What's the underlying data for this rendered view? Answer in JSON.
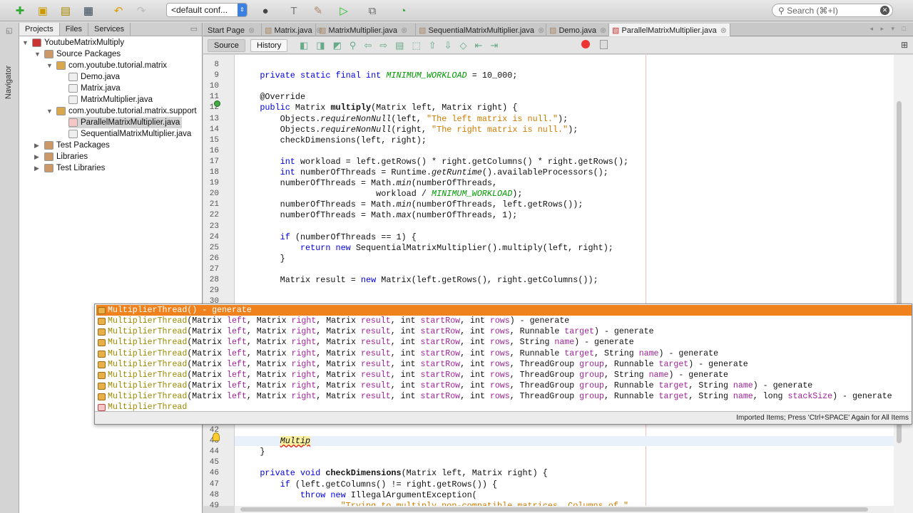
{
  "toolbar": {
    "config": "<default conf...",
    "search_placeholder": "Search (⌘+I)"
  },
  "navigator_label": "Navigator",
  "left_panel": {
    "tabs": [
      "Projects",
      "Files",
      "Services"
    ],
    "tree": [
      {
        "label": "YoutubeMatrixMultiply",
        "level": 0,
        "expanded": true,
        "icon": "project"
      },
      {
        "label": "Source Packages",
        "level": 1,
        "expanded": true,
        "icon": "folder"
      },
      {
        "label": "com.youtube.tutorial.matrix",
        "level": 2,
        "expanded": true,
        "icon": "package"
      },
      {
        "label": "Demo.java",
        "level": 3,
        "icon": "java-file"
      },
      {
        "label": "Matrix.java",
        "level": 3,
        "icon": "java-file"
      },
      {
        "label": "MatrixMultiplier.java",
        "level": 3,
        "icon": "java-file"
      },
      {
        "label": "com.youtube.tutorial.matrix.support",
        "level": 2,
        "expanded": true,
        "icon": "package"
      },
      {
        "label": "ParallelMatrixMultiplier.java",
        "level": 3,
        "icon": "java-error-file",
        "selected": true
      },
      {
        "label": "SequentialMatrixMultiplier.java",
        "level": 3,
        "icon": "java-file"
      },
      {
        "label": "Test Packages",
        "level": 1,
        "expanded": false,
        "icon": "folder"
      },
      {
        "label": "Libraries",
        "level": 1,
        "expanded": false,
        "icon": "folder"
      },
      {
        "label": "Test Libraries",
        "level": 1,
        "expanded": false,
        "icon": "folder"
      }
    ]
  },
  "editor_tabs": [
    {
      "label": "Start Page"
    },
    {
      "label": "Matrix.java"
    },
    {
      "label": "MatrixMultiplier.java"
    },
    {
      "label": "SequentialMatrixMultiplier.java"
    },
    {
      "label": "Demo.java"
    },
    {
      "label": "ParallelMatrixMultiplier.java",
      "active": true
    }
  ],
  "editor_toolbar": {
    "source": "Source",
    "history": "History"
  },
  "code_lines": [
    {
      "n": 8,
      "t": []
    },
    {
      "n": 9,
      "t": [
        [
          "    ",
          ""
        ],
        [
          "private static final int",
          "kw"
        ],
        [
          " ",
          ""
        ],
        [
          "MINIMUM_WORKLOAD",
          "fld"
        ],
        [
          " = 10_000;",
          ""
        ]
      ]
    },
    {
      "n": 10,
      "t": []
    },
    {
      "n": 11,
      "t": [
        [
          "    @Override",
          ""
        ]
      ]
    },
    {
      "n": 12,
      "t": [
        [
          "    ",
          ""
        ],
        [
          "public",
          "kw"
        ],
        [
          " Matrix ",
          ""
        ],
        [
          "multiply",
          "b"
        ],
        [
          "(Matrix left, Matrix right) {",
          ""
        ]
      ]
    },
    {
      "n": 13,
      "t": [
        [
          "        Objects.",
          ""
        ],
        [
          "requireNonNull",
          "it"
        ],
        [
          "(left, ",
          ""
        ],
        [
          "\"The left matrix is null.\"",
          "str"
        ],
        [
          ");",
          ""
        ]
      ]
    },
    {
      "n": 14,
      "t": [
        [
          "        Objects.",
          ""
        ],
        [
          "requireNonNull",
          "it"
        ],
        [
          "(right, ",
          ""
        ],
        [
          "\"The right matrix is null.\"",
          "str"
        ],
        [
          ");",
          ""
        ]
      ]
    },
    {
      "n": 15,
      "t": [
        [
          "        checkDimensions(left, right);",
          ""
        ]
      ]
    },
    {
      "n": 16,
      "t": []
    },
    {
      "n": 17,
      "t": [
        [
          "        ",
          ""
        ],
        [
          "int",
          "kw"
        ],
        [
          " workload = left.getRows() * right.getColumns() * right.getRows();",
          ""
        ]
      ]
    },
    {
      "n": 18,
      "t": [
        [
          "        ",
          ""
        ],
        [
          "int",
          "kw"
        ],
        [
          " numberOfThreads = Runtime.",
          ""
        ],
        [
          "getRuntime",
          "it"
        ],
        [
          "().availableProcessors();",
          ""
        ]
      ]
    },
    {
      "n": 19,
      "t": [
        [
          "        numberOfThreads = Math.",
          ""
        ],
        [
          "min",
          "it"
        ],
        [
          "(numberOfThreads,",
          ""
        ]
      ]
    },
    {
      "n": 20,
      "t": [
        [
          "                           workload / ",
          ""
        ],
        [
          "MINIMUM_WORKLOAD",
          "fld"
        ],
        [
          ");",
          ""
        ]
      ]
    },
    {
      "n": 21,
      "t": [
        [
          "        numberOfThreads = Math.",
          ""
        ],
        [
          "min",
          "it"
        ],
        [
          "(numberOfThreads, left.getRows());",
          ""
        ]
      ]
    },
    {
      "n": 22,
      "t": [
        [
          "        numberOfThreads = Math.",
          ""
        ],
        [
          "max",
          "it"
        ],
        [
          "(numberOfThreads, 1);",
          ""
        ]
      ]
    },
    {
      "n": 23,
      "t": []
    },
    {
      "n": 24,
      "t": [
        [
          "        ",
          ""
        ],
        [
          "if",
          "kw"
        ],
        [
          " (numberOfThreads == 1) {",
          ""
        ]
      ]
    },
    {
      "n": 25,
      "t": [
        [
          "            ",
          ""
        ],
        [
          "return new",
          "kw"
        ],
        [
          " SequentialMatrixMultiplier().multiply(left, right);",
          ""
        ]
      ]
    },
    {
      "n": 26,
      "t": [
        [
          "        }",
          ""
        ]
      ]
    },
    {
      "n": 27,
      "t": []
    },
    {
      "n": 28,
      "t": [
        [
          "        Matrix result = ",
          ""
        ],
        [
          "new",
          "kw"
        ],
        [
          " Matrix(left.getRows(), right.getColumns());",
          ""
        ]
      ]
    },
    {
      "n": 29,
      "t": []
    },
    {
      "n": 30,
      "t": []
    },
    {
      "n": 42,
      "t": []
    },
    {
      "n": 43,
      "t": [
        [
          "        ",
          ""
        ],
        [
          "Multip",
          "typing"
        ]
      ]
    },
    {
      "n": 44,
      "t": [
        [
          "    }",
          ""
        ]
      ]
    },
    {
      "n": 45,
      "t": []
    },
    {
      "n": 46,
      "t": [
        [
          "    ",
          ""
        ],
        [
          "private void",
          "kw"
        ],
        [
          " ",
          ""
        ],
        [
          "checkDimensions",
          "b"
        ],
        [
          "(Matrix left, Matrix right) {",
          ""
        ]
      ]
    },
    {
      "n": 47,
      "t": [
        [
          "        ",
          ""
        ],
        [
          "if",
          "kw"
        ],
        [
          " (left.getColumns() != right.getRows()) {",
          ""
        ]
      ]
    },
    {
      "n": 48,
      "t": [
        [
          "            ",
          ""
        ],
        [
          "throw new",
          "kw"
        ],
        [
          " IllegalArgumentException(",
          ""
        ]
      ]
    },
    {
      "n": 49,
      "t": [
        [
          "                    ",
          ""
        ],
        [
          "\"Trying to multiply non-compatible matrices. Columns of \"",
          "str"
        ]
      ]
    }
  ],
  "completion": {
    "name": "MultiplierThread",
    "suffix": " - generate",
    "base_params": [
      [
        "Matrix",
        "left"
      ],
      [
        "Matrix",
        "right"
      ],
      [
        "Matrix",
        "result"
      ],
      [
        "int",
        "startRow"
      ],
      [
        "int",
        "rows"
      ]
    ],
    "items": [
      {
        "params": null,
        "ctor": true,
        "selected": true
      },
      {
        "extra": []
      },
      {
        "extra": [
          [
            "Runnable",
            "target"
          ]
        ]
      },
      {
        "extra": [
          [
            "String",
            "name"
          ]
        ]
      },
      {
        "extra": [
          [
            "Runnable",
            "target"
          ],
          [
            "String",
            "name"
          ]
        ]
      },
      {
        "extra": [
          [
            "ThreadGroup",
            "group"
          ],
          [
            "Runnable",
            "target"
          ]
        ]
      },
      {
        "extra": [
          [
            "ThreadGroup",
            "group"
          ],
          [
            "String",
            "name"
          ]
        ]
      },
      {
        "extra": [
          [
            "ThreadGroup",
            "group"
          ],
          [
            "Runnable",
            "target"
          ],
          [
            "String",
            "name"
          ]
        ]
      },
      {
        "extra": [
          [
            "ThreadGroup",
            "group"
          ],
          [
            "Runnable",
            "target"
          ],
          [
            "String",
            "name"
          ],
          [
            "long",
            "stackSize"
          ]
        ]
      },
      {
        "class_only": true
      }
    ],
    "footer": "Imported Items; Press 'Ctrl+SPACE' Again for All Items"
  },
  "colors": {
    "selection": "#f0821e",
    "keyword": "#0000e6",
    "string": "#ce7b00",
    "field": "#009900"
  }
}
